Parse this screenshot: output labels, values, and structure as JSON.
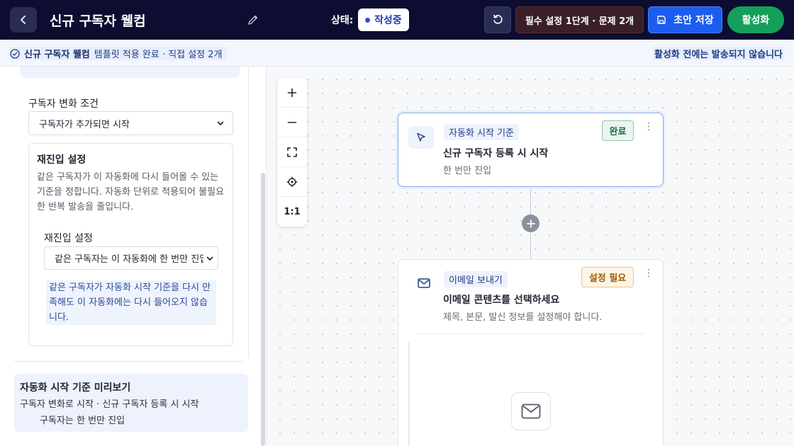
{
  "header": {
    "title": "신규 구독자 웰컴",
    "status_label": "상태:",
    "status_value": "작성중",
    "required_button": "필수 설정 1단계 · 문제 2개",
    "save_button": "초안 저장",
    "activate_button": "활성화"
  },
  "notice": {
    "title": "신규 구독자 웰컴",
    "message": "템플릿 적용 완료 · 직접 설정 2개",
    "right_message": "활성화 전에는 발송되지 않습니다"
  },
  "left_panel": {
    "subscriber_change_label": "구독자 변화 조건",
    "subscriber_change_value": "구독자가 추가되면 시작",
    "reentry": {
      "title": "재진입 설정",
      "description": "같은 구독자가 이 자동화에 다시 들어올 수 있는 기준을 정합니다. 자동화 단위로 적용되어 불필요한 반복 발송을 줄입니다.",
      "field_label": "재진입 설정",
      "field_value": "같은 구독자는 이 자동화에 한 번만 진입",
      "help_text": "같은 구독자가 자동화 시작 기준을 다시 만족해도 이 자동화에는 다시 들어오지 않습니다."
    },
    "preview": {
      "title": "자동화 시작 기준 미리보기",
      "line1": "구독자 변화로 시작 · 신규 구독자 등록 시 시작",
      "line2": "구독자는 한 번만 진입"
    }
  },
  "canvas": {
    "zoom_controls": [
      "+",
      "−",
      "fit",
      "center",
      "1:1"
    ],
    "nodes": [
      {
        "tag": "자동화 시작 기준",
        "heading": "신규 구독자 등록 시 시작",
        "sub": "한 번만 진입",
        "badge": "완료",
        "icon": "cursor-icon"
      },
      {
        "tag": "이메일 보내기",
        "heading": "이메일 콘텐츠를 선택하세요",
        "sub": "제목, 본문, 발신 정보를 설정해야 합니다.",
        "badge": "설정 필요",
        "icon": "mail-icon"
      }
    ]
  },
  "colors": {
    "header_bg": "#0c0d30",
    "primary": "#1c5df0",
    "success": "#14a05a",
    "warning": "#a05a06"
  }
}
